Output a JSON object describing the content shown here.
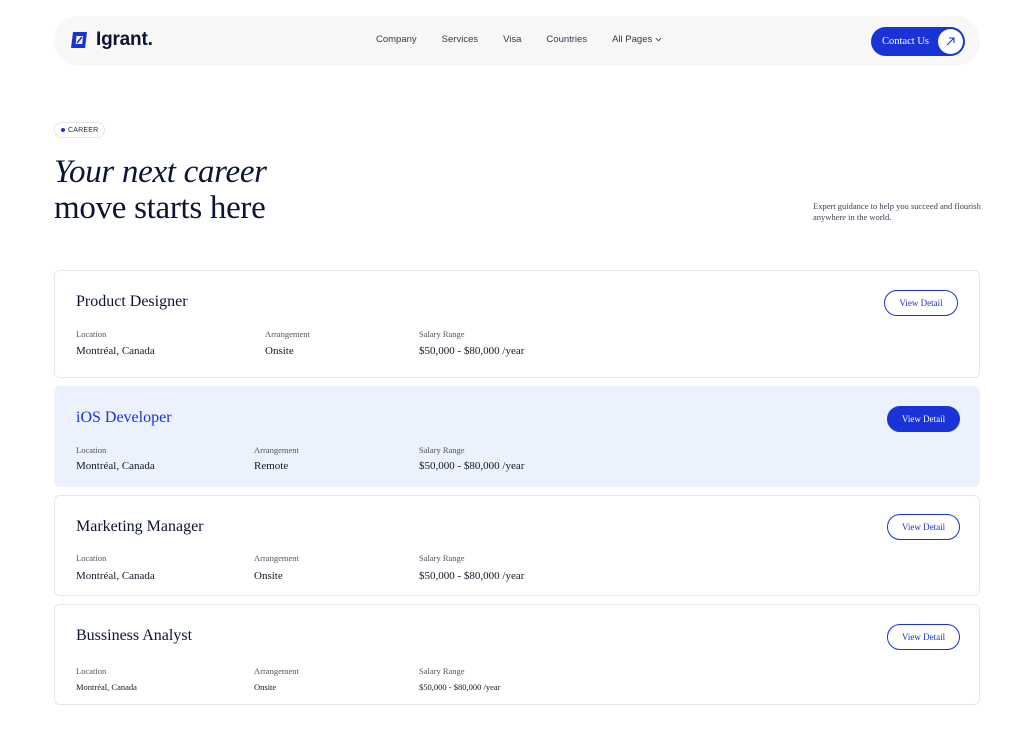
{
  "nav": {
    "logo": "Igrant.",
    "items": [
      {
        "label": "Company"
      },
      {
        "label": "Services"
      },
      {
        "label": "Visa"
      },
      {
        "label": "Countries"
      },
      {
        "label": "All Pages"
      }
    ],
    "contact_label": "Contact Us",
    "accent": "#1a33d6"
  },
  "hero": {
    "badge": "CAREER",
    "title_line1": "Your next career",
    "title_line2": "move starts here",
    "subtitle": "Expert guidance to help you succeed and flourish anywhere in the world."
  },
  "jobs": {
    "items": [
      {
        "title": "Product Designer",
        "location_label": "Location",
        "location": "Montréal, Canada",
        "arrangement_label": "Arrangement",
        "arrangement": "Onsite",
        "salary_label": "Salary Range",
        "salary": "$50,000 - $80,000 /year",
        "button": "View Detail"
      },
      {
        "title": "iOS Developer",
        "location_label": "Location",
        "location": "Montréal, Canada",
        "arrangement_label": "Arrangement",
        "arrangement": "Remote",
        "salary_label": "Salary Range",
        "salary": "$50,000 - $80,000 /year",
        "button": "View Detail"
      },
      {
        "title": "Marketing Manager",
        "location_label": "Location",
        "location": "Montréal, Canada",
        "arrangement_label": "Arrangement",
        "arrangement": "Onsite",
        "salary_label": "Salary Range",
        "salary": "$50,000 - $80,000 /year",
        "button": "View Detail"
      },
      {
        "title": "Bussiness Analyst",
        "location_label": "Location",
        "location": "Montréal, Canada",
        "arrangement_label": "Arrangement",
        "arrangement": "Onsite",
        "salary_label": "Salary Range",
        "salary": "$50,000 - $80,000 /year",
        "button": "View Detail"
      }
    ]
  }
}
